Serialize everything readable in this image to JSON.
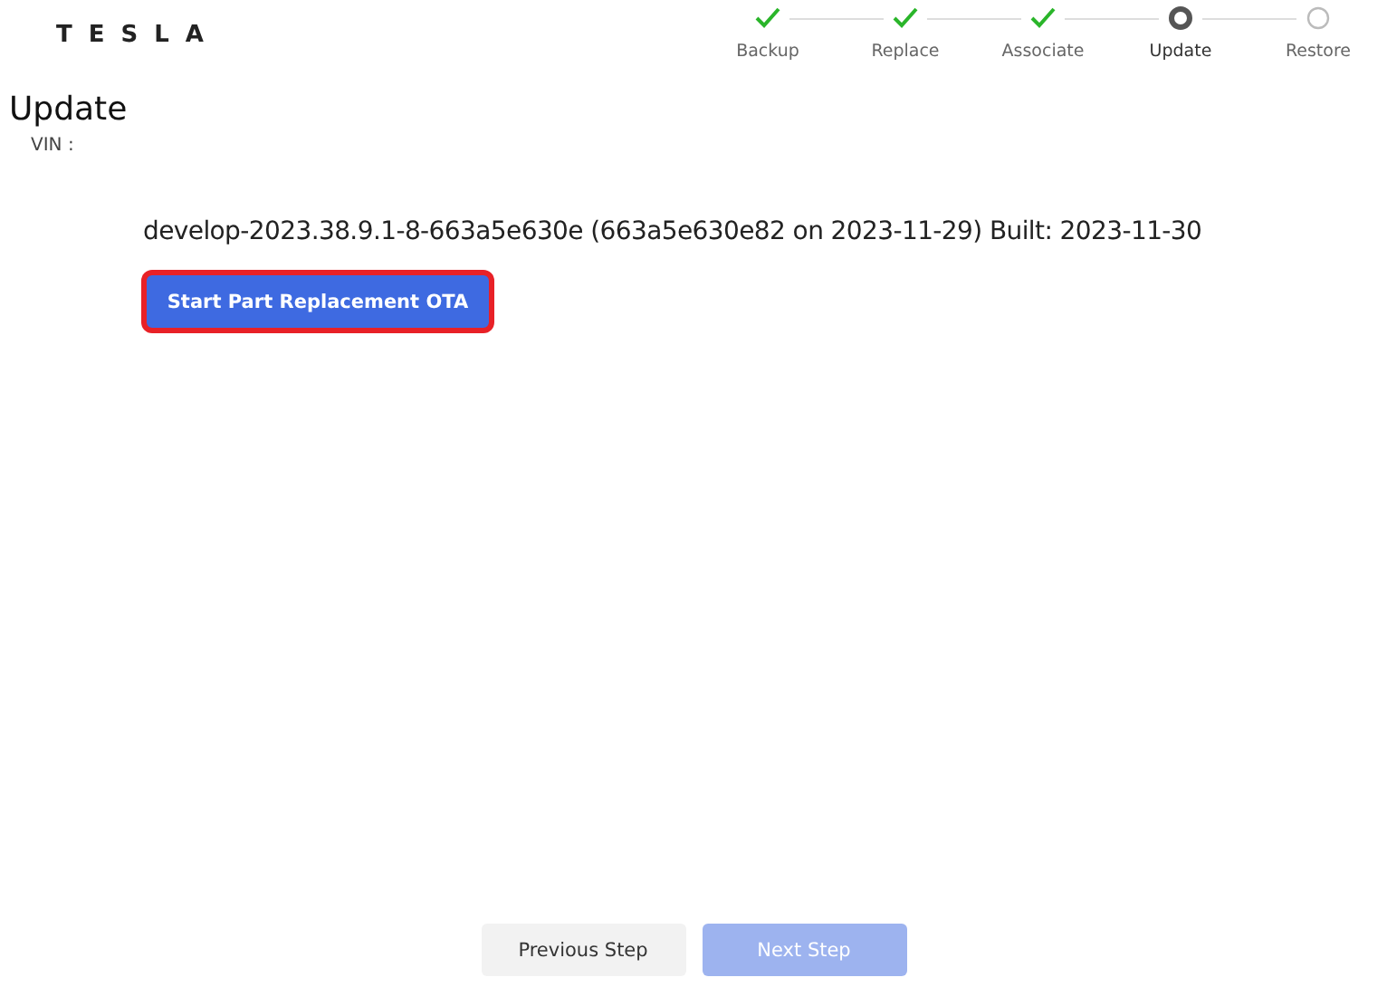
{
  "logo": "TESLA",
  "steps": [
    {
      "label": "Backup",
      "kind": "done"
    },
    {
      "label": "Replace",
      "kind": "done"
    },
    {
      "label": "Associate",
      "kind": "done"
    },
    {
      "label": "Update",
      "kind": "current"
    },
    {
      "label": "Restore",
      "kind": "pending"
    }
  ],
  "title": "Update",
  "vin_label": "VIN :",
  "build_info": "develop-2023.38.9.1-8-663a5e630e (663a5e630e82 on 2023-11-29) Built: 2023-11-30",
  "ota_button": {
    "label": "Start Part Replacement OTA",
    "focused": true
  },
  "footer_buttons": [
    {
      "label": "Previous Step",
      "kind": "secondary",
      "disabled": false
    },
    {
      "label": "Next Step",
      "kind": "primary",
      "disabled": true
    }
  ]
}
